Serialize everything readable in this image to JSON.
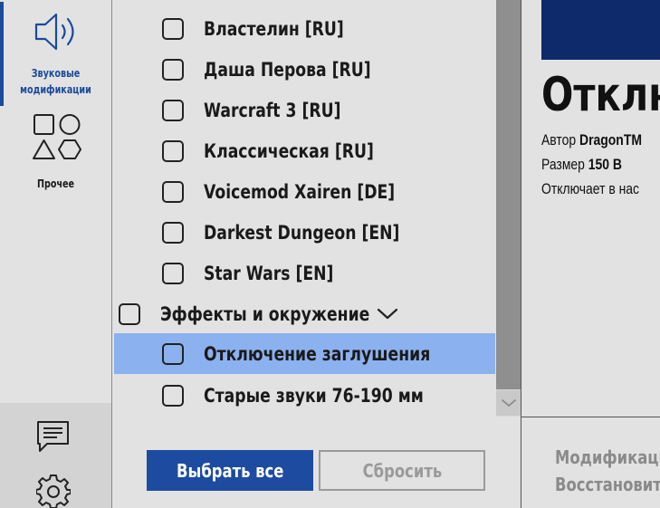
{
  "sidebar": {
    "items": [
      {
        "label_line1": "Звуковые",
        "label_line2": "модификации",
        "icon": "speaker-icon",
        "active": true
      },
      {
        "label": "Прочее",
        "icon": "shapes-icon",
        "active": false
      }
    ],
    "bottom_icons": [
      "feedback-icon",
      "gear-icon"
    ]
  },
  "mod_list": {
    "items": [
      {
        "label": "Властелин [RU]",
        "checked": false
      },
      {
        "label": "Даша Перова [RU]",
        "checked": false
      },
      {
        "label": "Warcraft 3 [RU]",
        "checked": false
      },
      {
        "label": "Классическая [RU]",
        "checked": false
      },
      {
        "label": "Voicemod Xairen [DE]",
        "checked": false
      },
      {
        "label": "Darkest Dungeon [EN]",
        "checked": false
      },
      {
        "label": "Star Wars [EN]",
        "checked": false
      }
    ],
    "category": {
      "label": "Эффекты и окружение",
      "checked": false,
      "expanded": true
    },
    "sub_items": [
      {
        "label": "Отключение заглушения",
        "checked": false,
        "selected": true
      },
      {
        "label": "Старые звуки 76-190 мм",
        "checked": false
      }
    ]
  },
  "buttons": {
    "select_all": "Выбрать все",
    "reset": "Сбросить"
  },
  "detail": {
    "title": "Отклю",
    "author_label": "Автор",
    "author_value": "DragonTM",
    "size_label": "Размер",
    "size_value": "150 B",
    "description": "Отключает в нас",
    "footer_line1": "Модификаци",
    "footer_line2": "Восстановит"
  },
  "colors": {
    "accent": "#1d4ba0",
    "selected_row": "#8cb1ef",
    "banner": "#0f2a6b",
    "background": "#e2e2e2"
  }
}
